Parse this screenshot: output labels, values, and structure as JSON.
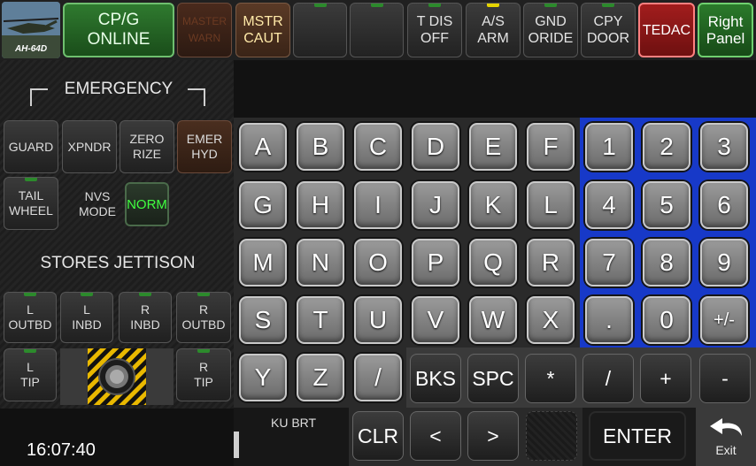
{
  "top": {
    "logo_text": "AH-64D",
    "cpg": [
      "CP/G",
      "ONLINE"
    ],
    "master_warn": [
      "MASTER",
      "WARN"
    ],
    "master_caut": [
      "MSTR",
      "CAUT"
    ],
    "blank1": "",
    "blank2": "",
    "tdis": [
      "T DIS",
      "OFF"
    ],
    "as_arm": [
      "A/S",
      "ARM"
    ],
    "gnd_oride": [
      "GND",
      "ORIDE"
    ],
    "cpy_door": [
      "CPY",
      "DOOR"
    ],
    "tedac": "TEDAC",
    "right_panel": [
      "Right",
      "Panel"
    ]
  },
  "left": {
    "emergency": "EMERGENCY",
    "guard": "GUARD",
    "xpndr": "XPNDR",
    "zeroize": [
      "ZERO",
      "RIZE"
    ],
    "emer_hyd": [
      "EMER",
      "HYD"
    ],
    "tail_wheel": [
      "TAIL",
      "WHEEL"
    ],
    "nvs_mode": [
      "NVS",
      "MODE"
    ],
    "norm": "NORM",
    "stores_jettison": "STORES JETTISON",
    "l_outbd": [
      "L",
      "OUTBD"
    ],
    "l_inbd": [
      "L",
      "INBD"
    ],
    "r_inbd": [
      "R",
      "INBD"
    ],
    "r_outbd": [
      "R",
      "OUTBD"
    ],
    "l_tip": [
      "L",
      "TIP"
    ],
    "r_tip": [
      "R",
      "TIP"
    ],
    "clock": "16:07:40"
  },
  "keyboard": {
    "letters": [
      "A",
      "B",
      "C",
      "D",
      "E",
      "F",
      "G",
      "H",
      "I",
      "J",
      "K",
      "L",
      "M",
      "N",
      "O",
      "P",
      "Q",
      "R",
      "S",
      "T",
      "U",
      "V",
      "W",
      "X",
      "Y",
      "Z",
      "/"
    ],
    "numbers": [
      "1",
      "2",
      "3",
      "4",
      "5",
      "6",
      "7",
      "8",
      "9",
      ".",
      "0",
      "+/-"
    ],
    "ops": [
      "BKS",
      "SPC",
      "*",
      "/",
      "+",
      "-"
    ],
    "ku_brt": "KU BRT",
    "clr": "CLR",
    "left": "<",
    "right": ">",
    "enter": "ENTER",
    "exit": "Exit"
  },
  "colors": {
    "numpad_bg": "#1739c8",
    "norm_text": "#40ff40",
    "tedac": "#a21d1d"
  }
}
